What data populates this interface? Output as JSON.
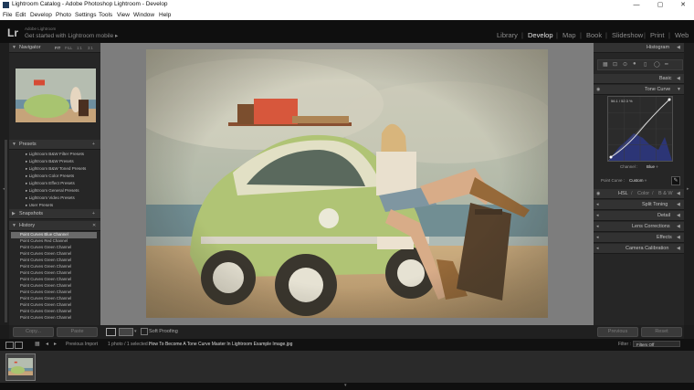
{
  "window": {
    "title": "Lightroom Catalog - Adobe Photoshop Lightroom - Develop",
    "controls": [
      "—",
      "▢",
      "✕"
    ]
  },
  "menu": [
    "File",
    "Edit",
    "Develop",
    "Photo",
    "Settings",
    "Tools",
    "View",
    "Window",
    "Help"
  ],
  "identity": {
    "logo": "Lr",
    "small": "Adobe Lightroom",
    "main": "Get started with Lightroom mobile  ▸"
  },
  "modules": [
    "Library",
    "Develop",
    "Map",
    "Book",
    "Slideshow",
    "Print",
    "Web"
  ],
  "active_module": "Develop",
  "left_panel": {
    "navigator": {
      "title": "Navigator",
      "zoom": [
        "FIT",
        "FILL",
        "1:1",
        "3:1"
      ]
    },
    "presets": {
      "title": "Presets",
      "items": [
        "Lightroom B&W Filter Presets",
        "Lightroom B&W Presets",
        "Lightroom B&W Toned Presets",
        "Lightroom Color Presets",
        "Lightroom Effect Presets",
        "Lightroom General Presets",
        "Lightroom Video Presets",
        "User Presets"
      ]
    },
    "snapshots": {
      "title": "Snapshots"
    },
    "history": {
      "title": "History",
      "items": [
        "Point Curves Blue Channel",
        "Point Curves Red Channel",
        "Point Curves Green Channel",
        "Point Curves Green Channel",
        "Point Curves Green Channel",
        "Point Curves Green Channel",
        "Point Curves Green Channel",
        "Point Curves Green Channel",
        "Point Curves Green Channel",
        "Point Curves Green Channel",
        "Point Curves Green Channel",
        "Point Curves Green Channel",
        "Point Curves Green Channel",
        "Point Curves Green Channel"
      ]
    },
    "copy_label": "Copy...",
    "paste_label": "Paste"
  },
  "right_panel": {
    "histogram": "Histogram",
    "basic": "Basic",
    "tone_curve": "Tone Curve",
    "curve_readout": "56.1 / 52.3 %",
    "channel_label": "Channel :",
    "channel_value": "Blue ÷",
    "point_curve_label": "Point Curve :",
    "point_curve_value": "Custom ÷",
    "hsl": "HSL",
    "color": "Color",
    "bw": "B & W",
    "sections": [
      "Split Toning",
      "Detail",
      "Lens Corrections",
      "Effects",
      "Camera Calibration"
    ],
    "previous_label": "Previous",
    "reset_label": "Reset"
  },
  "toolbar": {
    "soft_proofing": "Soft Proofing"
  },
  "filmstrip_bar": {
    "previous_import": "Previous Import",
    "count": "1 photo / 1 selected /",
    "filename": "How To Become A Tone Curve Master In Lightroom Example Image.jpg",
    "filter_label": "Filter :",
    "filter_value": "Filters Off"
  },
  "colors": {
    "panel": "#262626",
    "header": "#323232",
    "center_bg": "#7d7d7d",
    "curve_fill": "#2c3576",
    "accent_car": "#a8c470"
  }
}
